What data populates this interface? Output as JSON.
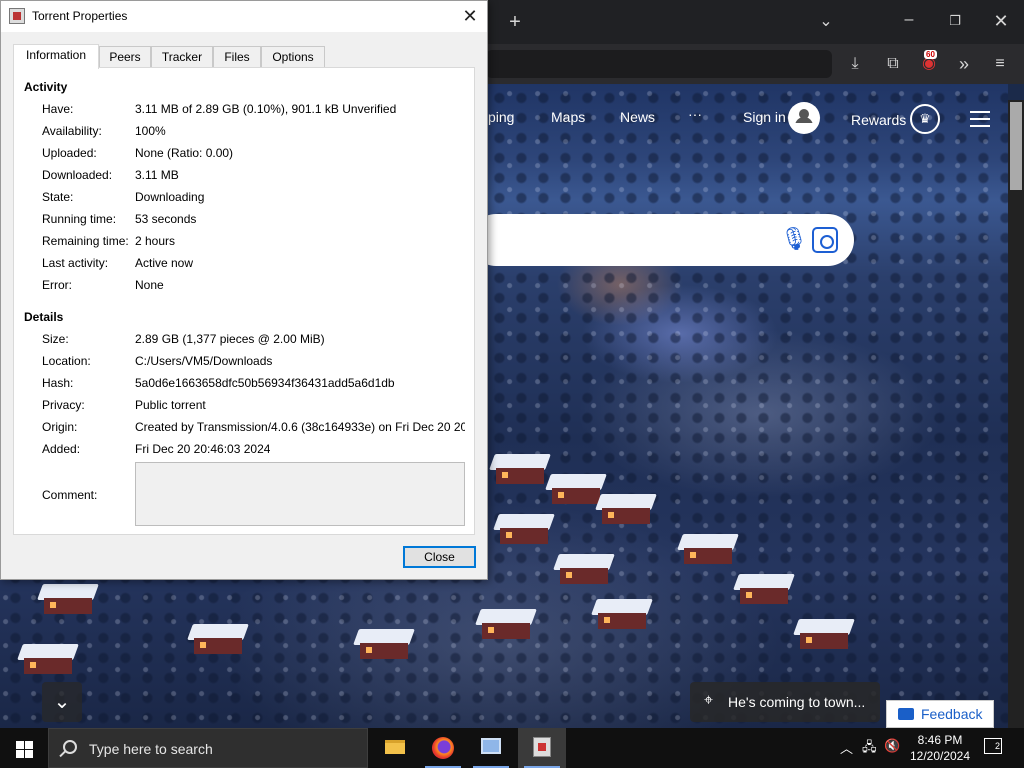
{
  "browser": {
    "nav": {
      "shopping_partial": "ping",
      "maps": "Maps",
      "news": "News",
      "more": "···",
      "sign_in": "Sign in",
      "rewards": "Rewards"
    },
    "extension_badge": "60",
    "caption": "He's coming to town...",
    "feedback": "Feedback"
  },
  "dialog": {
    "title": "Torrent Properties",
    "tabs": [
      "Information",
      "Peers",
      "Tracker",
      "Files",
      "Options"
    ],
    "activity_heading": "Activity",
    "activity": [
      {
        "label": "Have:",
        "value": "3.11 MB of 2.89 GB (0.10%), 901.1 kB Unverified"
      },
      {
        "label": "Availability:",
        "value": "100%"
      },
      {
        "label": "Uploaded:",
        "value": "None (Ratio: 0.00)"
      },
      {
        "label": "Downloaded:",
        "value": "3.11 MB"
      },
      {
        "label": "State:",
        "value": "Downloading"
      },
      {
        "label": "Running time:",
        "value": "53 seconds"
      },
      {
        "label": "Remaining time:",
        "value": "2 hours"
      },
      {
        "label": "Last activity:",
        "value": "Active now"
      },
      {
        "label": "Error:",
        "value": "None"
      }
    ],
    "details_heading": "Details",
    "details": [
      {
        "label": "Size:",
        "value": "2.89 GB (1,377 pieces @ 2.00 MiB)"
      },
      {
        "label": "Location:",
        "value": "C:/Users/VM5/Downloads"
      },
      {
        "label": "Hash:",
        "value": "5a0d6e1663658dfc50b56934f36431add5a6d1db"
      },
      {
        "label": "Privacy:",
        "value": "Public torrent"
      },
      {
        "label": "Origin:",
        "value": "Created by Transmission/4.0.6 (38c164933e) on Fri Dec 20 20:..."
      },
      {
        "label": "Added:",
        "value": "Fri Dec 20 20:46:03 2024"
      }
    ],
    "comment_label": "Comment:",
    "close_button": "Close"
  },
  "taskbar": {
    "search_placeholder": "Type here to search",
    "time": "8:46 PM",
    "date": "12/20/2024",
    "notification_count": "2"
  }
}
